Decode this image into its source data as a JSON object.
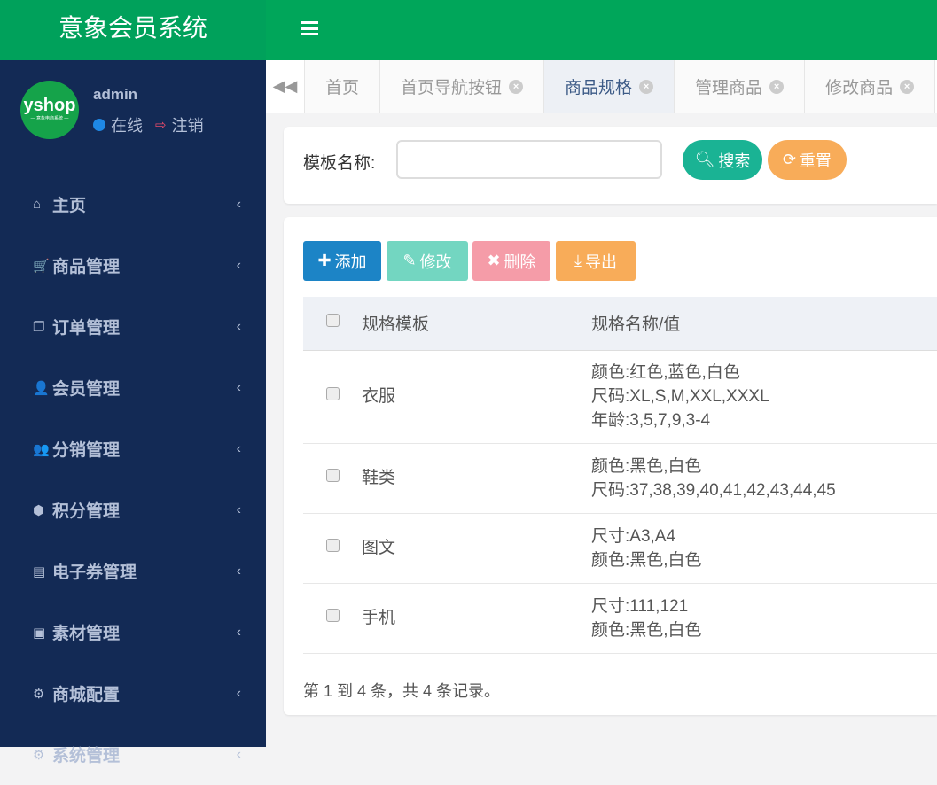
{
  "app": {
    "title": "意象会员系统"
  },
  "user": {
    "name": "admin",
    "status": "在线",
    "logout": "注销",
    "avatar_text": "yshop",
    "avatar_sub": "— 意象电商系统 —"
  },
  "menu": [
    {
      "label": "主页",
      "icon": "home-icon",
      "glyph": "⌂"
    },
    {
      "label": "商品管理",
      "icon": "cart-icon",
      "glyph": "🛒"
    },
    {
      "label": "订单管理",
      "icon": "copy-icon",
      "glyph": "❐"
    },
    {
      "label": "会员管理",
      "icon": "user-icon",
      "glyph": "👤"
    },
    {
      "label": "分销管理",
      "icon": "user-plus-icon",
      "glyph": "👥"
    },
    {
      "label": "积分管理",
      "icon": "cube-icon",
      "glyph": "⬢"
    },
    {
      "label": "电子券管理",
      "icon": "id-card-icon",
      "glyph": "▤"
    },
    {
      "label": "素材管理",
      "icon": "image-icon",
      "glyph": "▣"
    },
    {
      "label": "商城配置",
      "icon": "cogs-icon",
      "glyph": "⚙"
    },
    {
      "label": "系统管理",
      "icon": "gear-icon",
      "glyph": "⚙"
    }
  ],
  "tabs": [
    {
      "label": "首页",
      "closable": false
    },
    {
      "label": "首页导航按钮",
      "closable": true
    },
    {
      "label": "商品规格",
      "closable": true,
      "active": true
    },
    {
      "label": "管理商品",
      "closable": true
    },
    {
      "label": "修改商品",
      "closable": true
    }
  ],
  "search": {
    "label": "模板名称:",
    "value": "",
    "search_btn": "搜索",
    "reset_btn": "重置"
  },
  "toolbar": {
    "add": "添加",
    "edit": "修改",
    "delete": "删除",
    "export": "导出"
  },
  "table": {
    "headers": [
      "规格模板",
      "规格名称/值"
    ],
    "rows": [
      {
        "name": "衣服",
        "values": [
          "颜色:红色,蓝色,白色",
          "尺码:XL,S,M,XXL,XXXL",
          "年龄:3,5,7,9,3-4"
        ]
      },
      {
        "name": "鞋类",
        "values": [
          "颜色:黑色,白色",
          "尺码:37,38,39,40,41,42,43,44,45"
        ]
      },
      {
        "name": "图文",
        "values": [
          "尺寸:A3,A4",
          "颜色:黑色,白色"
        ]
      },
      {
        "name": "手机",
        "values": [
          "尺寸:111,121",
          "颜色:黑色,白色"
        ]
      }
    ]
  },
  "pagination": {
    "summary": "第 1 到 4 条，共 4 条记录。"
  }
}
